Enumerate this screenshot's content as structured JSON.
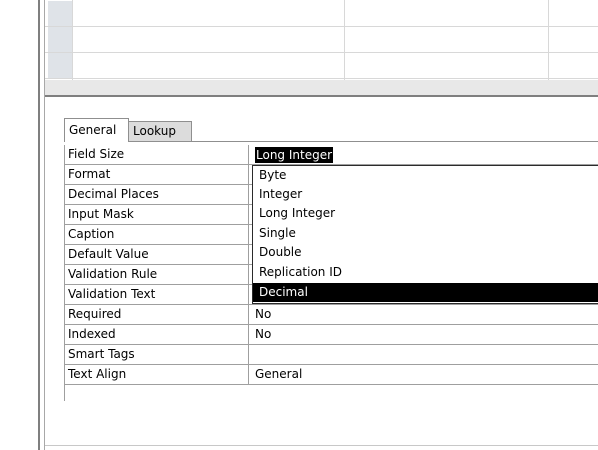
{
  "tabs": {
    "general": "General",
    "lookup": "Lookup"
  },
  "properties": [
    {
      "name": "Field Size",
      "value": ""
    },
    {
      "name": "Format",
      "value": ""
    },
    {
      "name": "Decimal Places",
      "value": ""
    },
    {
      "name": "Input Mask",
      "value": ""
    },
    {
      "name": "Caption",
      "value": ""
    },
    {
      "name": "Default Value",
      "value": ""
    },
    {
      "name": "Validation Rule",
      "value": ""
    },
    {
      "name": "Validation Text",
      "value": ""
    },
    {
      "name": "Required",
      "value": "No"
    },
    {
      "name": "Indexed",
      "value": "No"
    },
    {
      "name": "Smart Tags",
      "value": ""
    },
    {
      "name": "Text Align",
      "value": "General"
    }
  ],
  "field_size_selected": "Long Integer",
  "dropdown": {
    "options": [
      "Byte",
      "Integer",
      "Long Integer",
      "Single",
      "Double",
      "Replication ID",
      "Decimal"
    ],
    "highlighted": "Decimal"
  },
  "colors": {
    "selection": "#000000",
    "grid_line": "#d8d8d8",
    "row_selector": "#dfe3e8"
  }
}
